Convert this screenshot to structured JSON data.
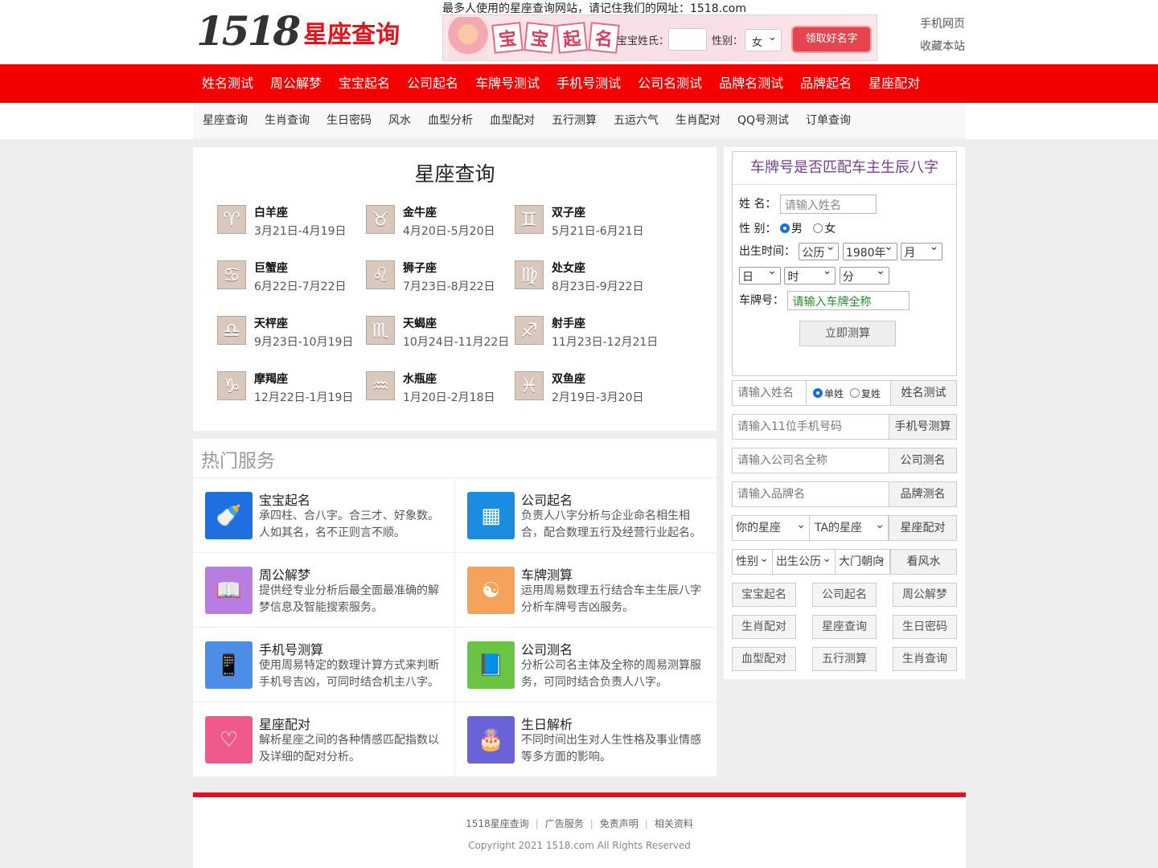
{
  "header": {
    "logo_num": "1518",
    "logo_text": "星座查询",
    "tagline": "最多人使用的星座查询网站，请记住我们的网址：1518.com",
    "banner": {
      "tiles": [
        "宝",
        "宝",
        "起",
        "名"
      ],
      "surname_label": "宝宝姓氏：",
      "gender_label": "性别：",
      "gender_value": "女",
      "button": "领取好名字"
    },
    "links": [
      "手机网页",
      "收藏本站"
    ]
  },
  "nav_main": [
    "姓名测试",
    "周公解梦",
    "宝宝起名",
    "公司起名",
    "车牌号测试",
    "手机号测试",
    "公司名测试",
    "品牌名测试",
    "品牌起名",
    "星座配对"
  ],
  "nav_sub": [
    "星座查询",
    "生肖查询",
    "生日密码",
    "风水",
    "血型分析",
    "血型配对",
    "五行测算",
    "五运六气",
    "生肖配对",
    "QQ号测试",
    "订单查询"
  ],
  "zodiac": {
    "title": "星座查询",
    "items": [
      {
        "symbol": "♈",
        "name": "白羊座",
        "date": "3月21日-4月19日"
      },
      {
        "symbol": "♉",
        "name": "金牛座",
        "date": "4月20日-5月20日"
      },
      {
        "symbol": "♊",
        "name": "双子座",
        "date": "5月21日-6月21日"
      },
      {
        "symbol": "♋",
        "name": "巨蟹座",
        "date": "6月22日-7月22日"
      },
      {
        "symbol": "♌",
        "name": "狮子座",
        "date": "7月23日-8月22日"
      },
      {
        "symbol": "♍",
        "name": "处女座",
        "date": "8月23日-9月22日"
      },
      {
        "symbol": "♎",
        "name": "天枰座",
        "date": "9月23日-10月19日"
      },
      {
        "symbol": "♏",
        "name": "天蝎座",
        "date": "10月24日-11月22日"
      },
      {
        "symbol": "♐",
        "name": "射手座",
        "date": "11月23日-12月21日"
      },
      {
        "symbol": "♑",
        "name": "摩羯座",
        "date": "12月22日-1月19日"
      },
      {
        "symbol": "♒",
        "name": "水瓶座",
        "date": "1月20日-2月18日"
      },
      {
        "symbol": "♓",
        "name": "双鱼座",
        "date": "2月19日-3月20日"
      }
    ]
  },
  "hot": {
    "title": "热门服务",
    "items": [
      {
        "icon": "baby-bottle-icon",
        "glyph": "🍼",
        "color": "#1e6fe0",
        "title": "宝宝起名",
        "desc": "承四柱、合八字。合三才、好象数。人如其名，名不正则言不顺。"
      },
      {
        "icon": "building-icon",
        "glyph": "▦",
        "color": "#1a8de0",
        "title": "公司起名",
        "desc": "负责人八字分析与企业命名相生相合，配合数理五行及经营行业起名。"
      },
      {
        "icon": "book-icon",
        "glyph": "📖",
        "color": "#b77de0",
        "title": "周公解梦",
        "desc": "提供经专业分析后最全面最准确的解梦信息及智能搜索服务。"
      },
      {
        "icon": "bagua-icon",
        "glyph": "☯",
        "color": "#f5a25a",
        "title": "车牌测算",
        "desc": "运用周易数理五行结合车主生辰八字分析车牌号吉凶服务。"
      },
      {
        "icon": "phone-test-icon",
        "glyph": "📱",
        "color": "#4c8de8",
        "title": "手机号测算",
        "desc": "使用周易特定的数理计算方式来判断手机号吉凶，可同时结合机主八字。"
      },
      {
        "icon": "open-book-icon",
        "glyph": "📘",
        "color": "#6cc444",
        "title": "公司测名",
        "desc": "分析公司名主体及全称的周易测算服务，可同时结合负责人八字。"
      },
      {
        "icon": "hearts-icon",
        "glyph": "♡",
        "color": "#f05a8a",
        "title": "星座配对",
        "desc": "解析星座之间的各种情感匹配指数以及详细的配对分析。"
      },
      {
        "icon": "cake-icon",
        "glyph": "🎂",
        "color": "#6a62d8",
        "title": "生日解析",
        "desc": "不同时间出生对人生性格及事业情感等多方面的影响。"
      }
    ]
  },
  "plate_form": {
    "title": "车牌号是否匹配车主生辰八字",
    "name_label": "姓 名：",
    "name_placeholder": "请输入姓名",
    "gender_label": "性 别：",
    "male": "男",
    "female": "女",
    "birth_label": "出生时间：",
    "calendar": "公历",
    "year": "1980年",
    "month": "月",
    "day": "日",
    "hour": "时",
    "minute": "分",
    "plate_label": "车牌号：",
    "plate_placeholder": "请输入车牌全称",
    "submit": "立即测算"
  },
  "side_tools": {
    "name_test": {
      "placeholder": "请输入姓名",
      "single": "单姓",
      "double": "复姓",
      "button": "姓名测试"
    },
    "phone": {
      "placeholder": "请输入11位手机号码",
      "button": "手机号测算"
    },
    "company": {
      "placeholder": "请输入公司名全称",
      "button": "公司测名"
    },
    "brand": {
      "placeholder": "请输入品牌名",
      "button": "品牌测名"
    },
    "match": {
      "sel1": "你的星座",
      "sel2": "TA的星座",
      "button": "星座配对"
    },
    "fengshui": {
      "sel1": "性别",
      "sel2": "出生公历",
      "sel3": "大门朝向",
      "button": "看风水"
    },
    "tags": [
      "宝宝起名",
      "公司起名",
      "周公解梦",
      "生肖配对",
      "星座查询",
      "生日密码",
      "血型配对",
      "五行测算",
      "生肖查询"
    ]
  },
  "footer": {
    "links": [
      "1518星座查询",
      "广告服务",
      "免责声明",
      "相关资料"
    ],
    "copyright": "Copyright 2021 1518.com All Rights Reserved"
  }
}
